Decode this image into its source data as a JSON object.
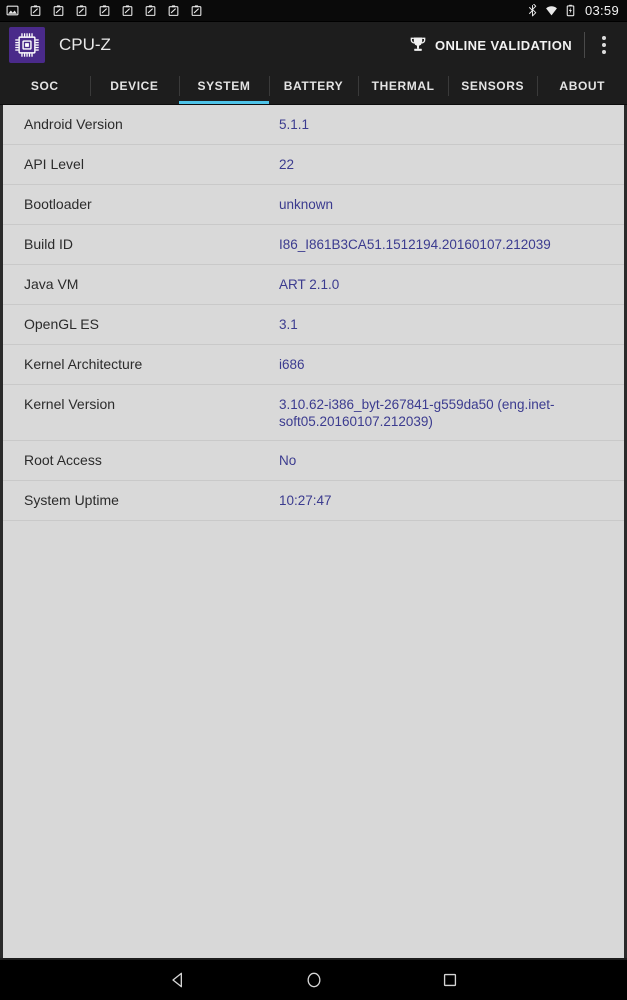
{
  "status_bar": {
    "notification_icons": [
      "image-icon",
      "screenshot-icon",
      "screenshot-icon",
      "screenshot-icon",
      "screenshot-icon",
      "screenshot-icon",
      "screenshot-icon",
      "screenshot-icon",
      "screenshot-icon"
    ],
    "system_icons": [
      "bluetooth-icon",
      "wifi-icon",
      "battery-icon"
    ],
    "clock": "03:59"
  },
  "app_bar": {
    "app_icon": "cpu-chip-icon",
    "title": "CPU-Z",
    "validation_icon": "trophy-icon",
    "validation_label": "ONLINE VALIDATION",
    "overflow_icon": "more-vert-icon"
  },
  "tabs": {
    "active_index": 2,
    "accent_color": "#4ec3e8",
    "items": [
      {
        "label": "SOC"
      },
      {
        "label": "DEVICE"
      },
      {
        "label": "SYSTEM"
      },
      {
        "label": "BATTERY"
      },
      {
        "label": "THERMAL"
      },
      {
        "label": "SENSORS"
      },
      {
        "label": "ABOUT"
      }
    ]
  },
  "system_info": {
    "rows": [
      {
        "label": "Android Version",
        "value": "5.1.1"
      },
      {
        "label": "API Level",
        "value": "22"
      },
      {
        "label": "Bootloader",
        "value": "unknown"
      },
      {
        "label": "Build ID",
        "value": "I86_I861B3CA51.1512194.20160107.212039"
      },
      {
        "label": "Java VM",
        "value": "ART 2.1.0"
      },
      {
        "label": "OpenGL ES",
        "value": "3.1"
      },
      {
        "label": "Kernel Architecture",
        "value": "i686"
      },
      {
        "label": "Kernel Version",
        "value": "3.10.62-i386_byt-267841-g559da50 (eng.inet-soft05.20160107.212039)"
      },
      {
        "label": "Root Access",
        "value": "No"
      },
      {
        "label": "System Uptime",
        "value": "10:27:47"
      }
    ]
  },
  "nav_bar": {
    "buttons": [
      {
        "name": "back-icon"
      },
      {
        "name": "home-icon"
      },
      {
        "name": "recents-icon"
      }
    ]
  },
  "colors": {
    "accent": "#4ec3e8",
    "value_text": "#3b3b8f",
    "label_text": "#2b2b2b",
    "content_bg": "#d9d9d9",
    "appbar_bg": "#1d1d1d",
    "logo_bg": "#4a2a8a"
  }
}
